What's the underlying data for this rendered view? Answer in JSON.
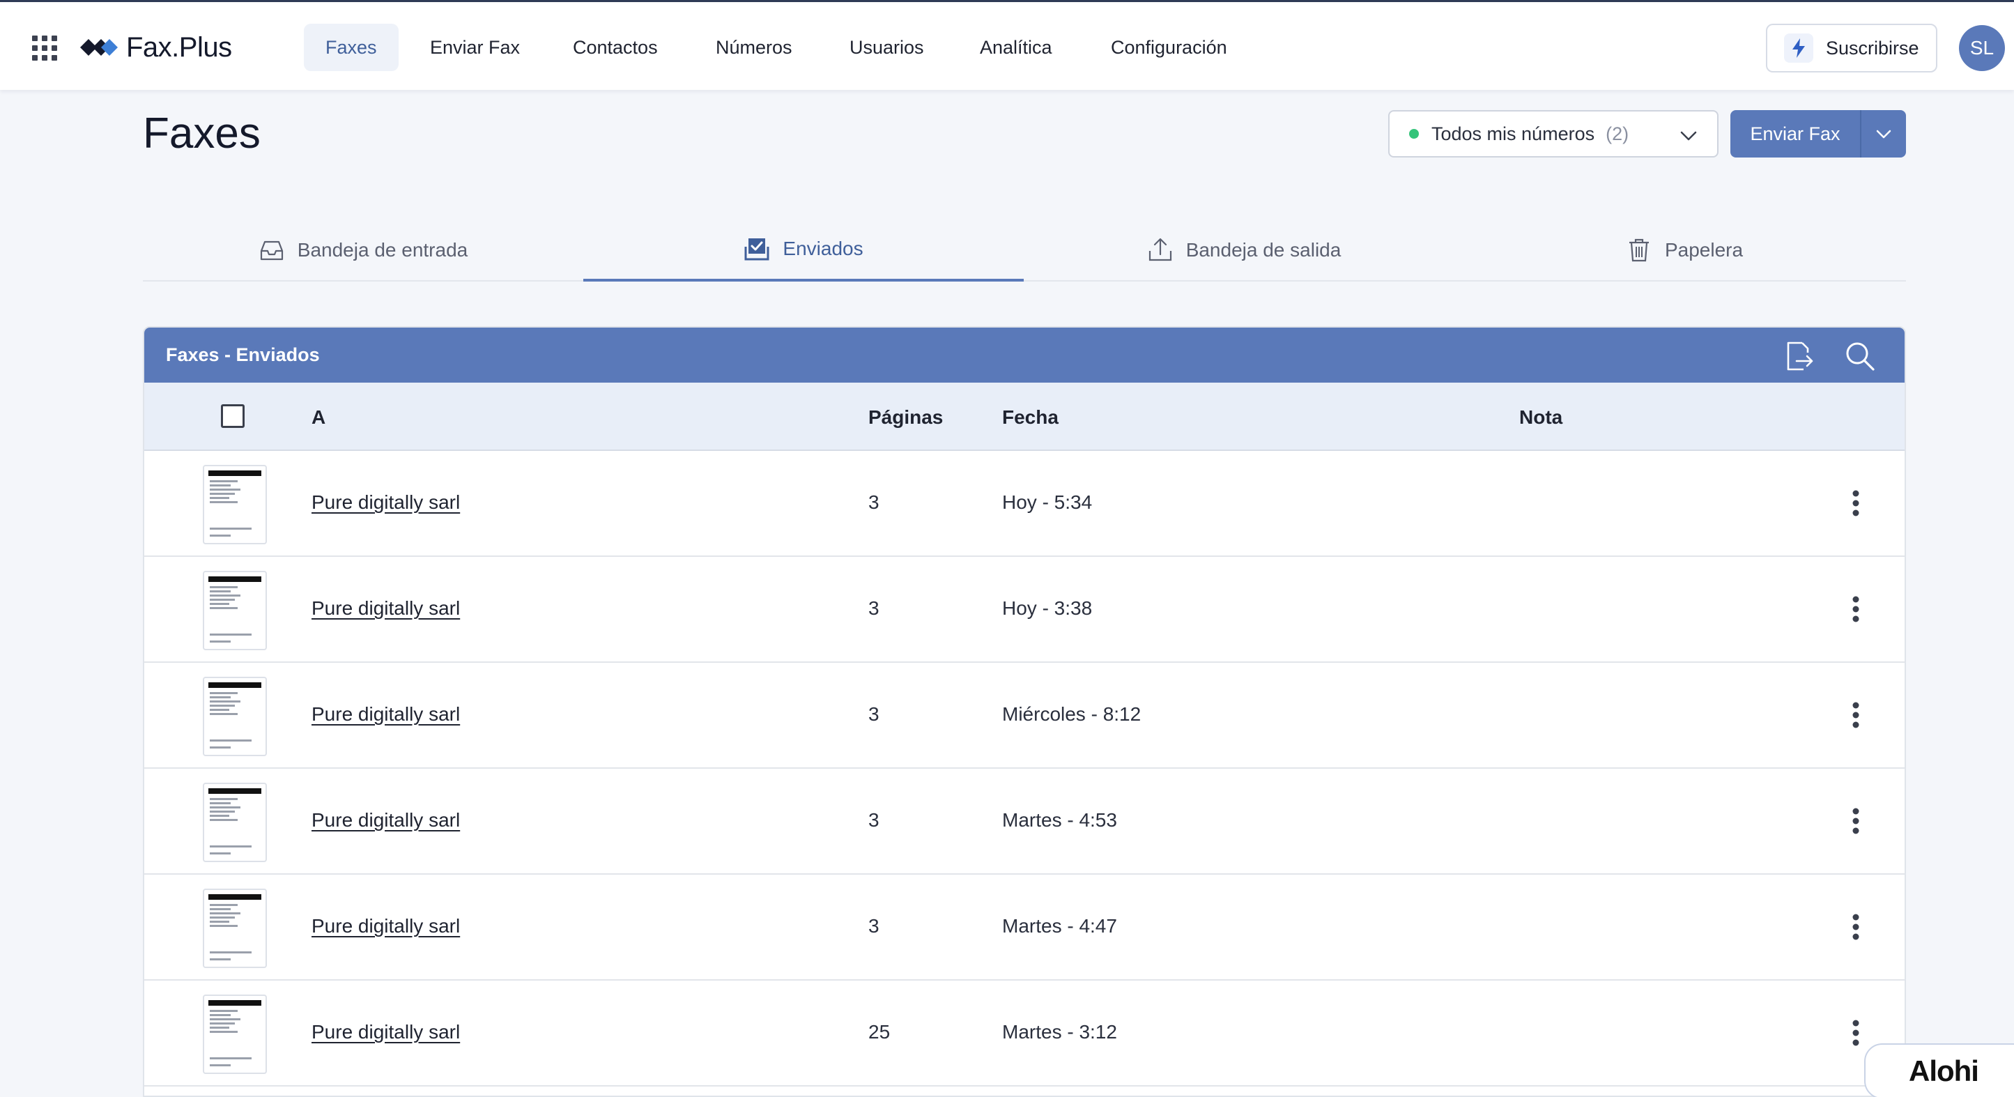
{
  "app": {
    "brand": "Fax.Plus",
    "nav": [
      {
        "label": "Faxes",
        "active": true
      },
      {
        "label": "Enviar Fax",
        "active": false
      },
      {
        "label": "Contactos",
        "active": false
      },
      {
        "label": "Números",
        "active": false
      },
      {
        "label": "Usuarios",
        "active": false
      },
      {
        "label": "Analítica",
        "active": false
      },
      {
        "label": "Configuración",
        "active": false
      }
    ],
    "subscribe_label": "Suscribirse",
    "avatar_initials": "SL"
  },
  "page": {
    "title": "Faxes",
    "number_filter": {
      "label": "Todos mis números",
      "count": "(2)"
    },
    "send_fax_label": "Enviar Fax"
  },
  "tabs": [
    {
      "label": "Bandeja de entrada",
      "icon": "inbox-icon",
      "active": false
    },
    {
      "label": "Enviados",
      "icon": "sent-check-icon",
      "active": true
    },
    {
      "label": "Bandeja de salida",
      "icon": "outbox-upload-icon",
      "active": false
    },
    {
      "label": "Papelera",
      "icon": "trash-icon",
      "active": false
    }
  ],
  "table": {
    "title": "Faxes - Enviados",
    "columns": {
      "to": "A",
      "pages": "Páginas",
      "date": "Fecha",
      "note": "Nota"
    },
    "rows": [
      {
        "to": "Pure digitally sarl",
        "pages": "3",
        "date": "Hoy - 5:34",
        "note": ""
      },
      {
        "to": "Pure digitally sarl",
        "pages": "3",
        "date": "Hoy - 3:38",
        "note": ""
      },
      {
        "to": "Pure digitally sarl",
        "pages": "3",
        "date": "Miércoles - 8:12",
        "note": ""
      },
      {
        "to": "Pure digitally sarl",
        "pages": "3",
        "date": "Martes - 4:53",
        "note": ""
      },
      {
        "to": "Pure digitally sarl",
        "pages": "3",
        "date": "Martes - 4:47",
        "note": ""
      },
      {
        "to": "Pure digitally sarl",
        "pages": "25",
        "date": "Martes - 3:12",
        "note": ""
      }
    ]
  },
  "badge": {
    "label": "Alohi"
  },
  "colors": {
    "accent": "#5a79b9",
    "status_dot": "#35c47a",
    "header_row": "#e8eef8"
  }
}
